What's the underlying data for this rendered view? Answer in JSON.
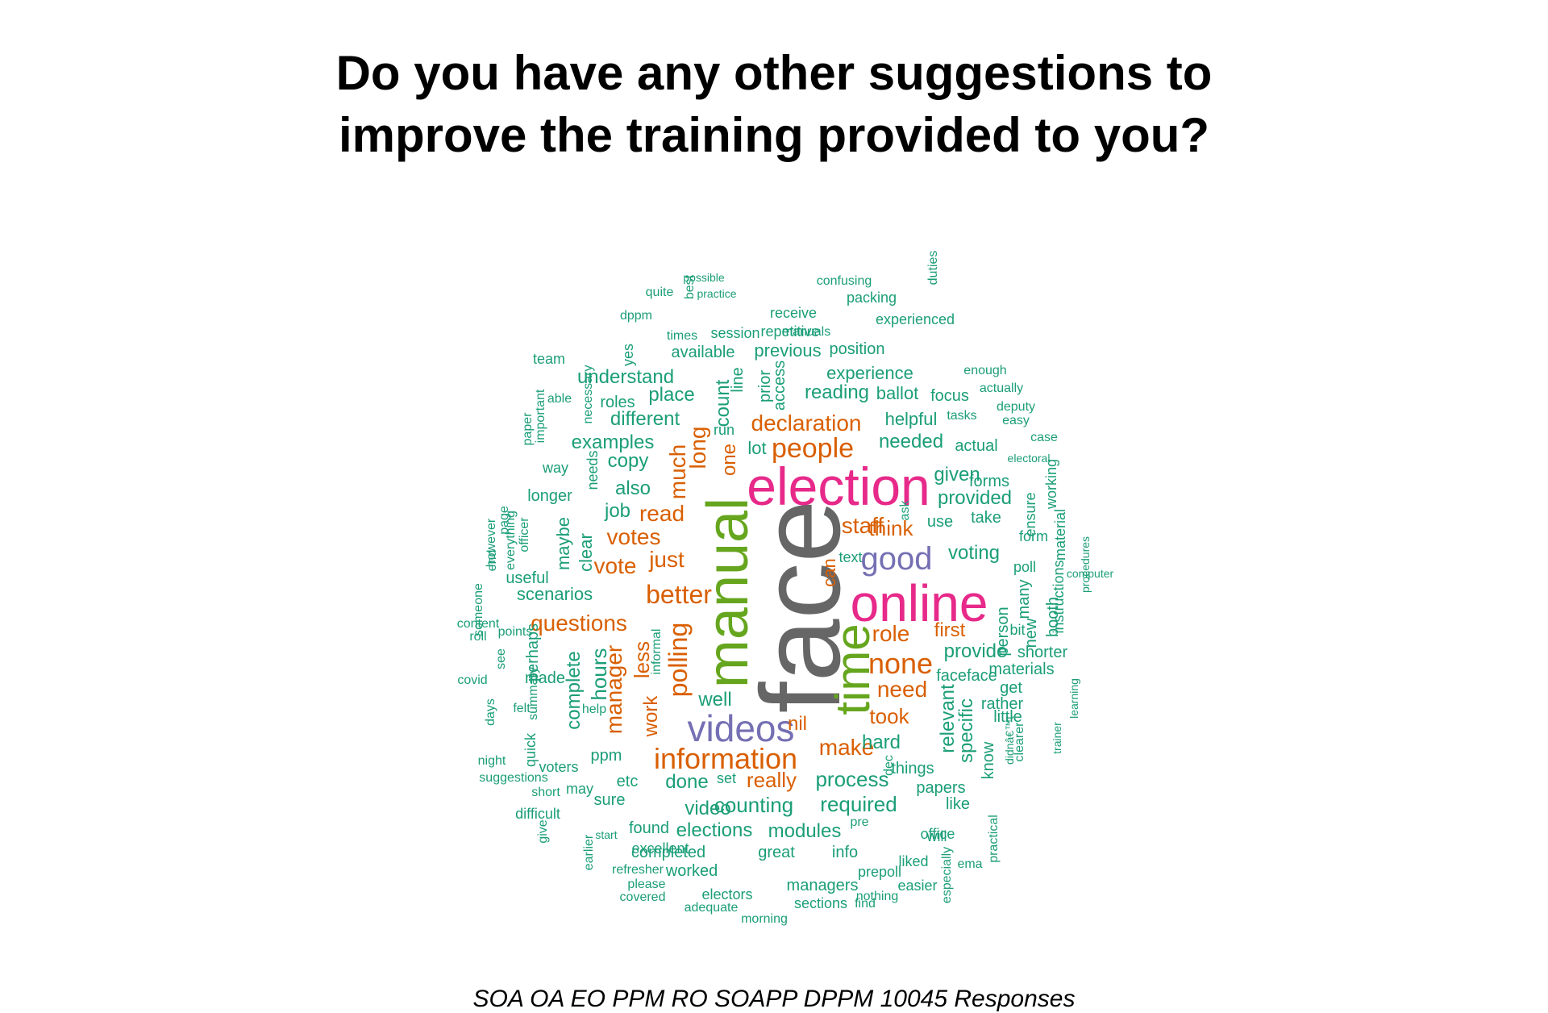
{
  "title": {
    "line1": "Do you have any other suggestions to",
    "line2": "improve the training provided to you?"
  },
  "footer": "SOA OA EO PPM RO SOAPP DPPM 10045 Responses",
  "colors": {
    "gray": "#666666",
    "green": "#66a61e",
    "pink": "#e7298a",
    "purple": "#7570b3",
    "orange": "#d95f02",
    "teal": "#1b9e77"
  },
  "words": [
    {
      "t": "face",
      "c": "gray",
      "v": 1
    },
    {
      "t": "manual",
      "c": "green",
      "v": 1
    },
    {
      "t": "election",
      "c": "pink",
      "v": 0
    },
    {
      "t": "online",
      "c": "pink",
      "v": 0
    },
    {
      "t": "time",
      "c": "green",
      "v": 1
    },
    {
      "t": "videos",
      "c": "purple",
      "v": 0
    },
    {
      "t": "good",
      "c": "purple",
      "v": 0
    },
    {
      "t": "information",
      "c": "orange",
      "v": 0
    },
    {
      "t": "none",
      "c": "orange",
      "v": 0
    },
    {
      "t": "people",
      "c": "orange",
      "v": 0
    },
    {
      "t": "better",
      "c": "orange",
      "v": 0
    },
    {
      "t": "polling",
      "c": "orange",
      "v": 1
    },
    {
      "t": "declaration",
      "c": "orange",
      "v": 0
    },
    {
      "t": "staff",
      "c": "orange",
      "v": 0
    },
    {
      "t": "role",
      "c": "orange",
      "v": 0
    },
    {
      "t": "questions",
      "c": "orange",
      "v": 0
    },
    {
      "t": "make",
      "c": "orange",
      "v": 0
    },
    {
      "t": "need",
      "c": "orange",
      "v": 0
    },
    {
      "t": "votes",
      "c": "orange",
      "v": 0
    },
    {
      "t": "just",
      "c": "orange",
      "v": 0
    },
    {
      "t": "took",
      "c": "orange",
      "v": 0
    },
    {
      "t": "read",
      "c": "orange",
      "v": 0
    },
    {
      "t": "think",
      "c": "orange",
      "v": 0
    },
    {
      "t": "vote",
      "c": "orange",
      "v": 0
    },
    {
      "t": "really",
      "c": "orange",
      "v": 0
    },
    {
      "t": "first",
      "c": "orange",
      "v": 0
    },
    {
      "t": "long",
      "c": "orange",
      "v": 1
    },
    {
      "t": "much",
      "c": "orange",
      "v": 1
    },
    {
      "t": "one",
      "c": "orange",
      "v": 1
    },
    {
      "t": "can",
      "c": "orange",
      "v": 1
    },
    {
      "t": "manager",
      "c": "orange",
      "v": 1
    },
    {
      "t": "less",
      "c": "orange",
      "v": 1
    },
    {
      "t": "work",
      "c": "orange",
      "v": 1
    },
    {
      "t": "nil",
      "c": "orange",
      "v": 0
    },
    {
      "t": "hours",
      "c": "teal",
      "v": 1
    },
    {
      "t": "complete",
      "c": "teal",
      "v": 1
    },
    {
      "t": "process",
      "c": "teal",
      "v": 0
    },
    {
      "t": "counting",
      "c": "teal",
      "v": 0
    },
    {
      "t": "done",
      "c": "teal",
      "v": 0
    },
    {
      "t": "hard",
      "c": "teal",
      "v": 0
    },
    {
      "t": "provide",
      "c": "teal",
      "v": 0
    },
    {
      "t": "provided",
      "c": "teal",
      "v": 0
    },
    {
      "t": "voting",
      "c": "teal",
      "v": 0
    },
    {
      "t": "relevant",
      "c": "teal",
      "v": 1
    },
    {
      "t": "specific",
      "c": "teal",
      "v": 1
    },
    {
      "t": "required",
      "c": "teal",
      "v": 0
    },
    {
      "t": "elections",
      "c": "teal",
      "v": 0
    },
    {
      "t": "modules",
      "c": "teal",
      "v": 0
    },
    {
      "t": "video",
      "c": "teal",
      "v": 0
    },
    {
      "t": "well",
      "c": "teal",
      "v": 0
    },
    {
      "t": "also",
      "c": "teal",
      "v": 0
    },
    {
      "t": "job",
      "c": "teal",
      "v": 0
    },
    {
      "t": "copy",
      "c": "teal",
      "v": 0
    },
    {
      "t": "examples",
      "c": "teal",
      "v": 0
    },
    {
      "t": "different",
      "c": "teal",
      "v": 0
    },
    {
      "t": "place",
      "c": "teal",
      "v": 0
    },
    {
      "t": "understand",
      "c": "teal",
      "v": 0
    },
    {
      "t": "roles",
      "c": "teal",
      "v": 0
    },
    {
      "t": "count",
      "c": "teal",
      "v": 1
    },
    {
      "t": "run",
      "c": "teal",
      "v": 0
    },
    {
      "t": "lot",
      "c": "teal",
      "v": 0
    },
    {
      "t": "reading",
      "c": "teal",
      "v": 0
    },
    {
      "t": "ballot",
      "c": "teal",
      "v": 0
    },
    {
      "t": "focus",
      "c": "teal",
      "v": 0
    },
    {
      "t": "helpful",
      "c": "teal",
      "v": 0
    },
    {
      "t": "needed",
      "c": "teal",
      "v": 0
    },
    {
      "t": "actual",
      "c": "teal",
      "v": 0
    },
    {
      "t": "given",
      "c": "teal",
      "v": 0
    },
    {
      "t": "forms",
      "c": "teal",
      "v": 0
    },
    {
      "t": "use",
      "c": "teal",
      "v": 0
    },
    {
      "t": "take",
      "c": "teal",
      "v": 0
    },
    {
      "t": "experience",
      "c": "teal",
      "v": 0
    },
    {
      "t": "previous",
      "c": "teal",
      "v": 0
    },
    {
      "t": "position",
      "c": "teal",
      "v": 0
    },
    {
      "t": "available",
      "c": "teal",
      "v": 0
    },
    {
      "t": "scenarios",
      "c": "teal",
      "v": 0
    },
    {
      "t": "useful",
      "c": "teal",
      "v": 0
    },
    {
      "t": "longer",
      "c": "teal",
      "v": 0
    },
    {
      "t": "maybe",
      "c": "teal",
      "v": 1
    },
    {
      "t": "clear",
      "c": "teal",
      "v": 1
    },
    {
      "t": "needs",
      "c": "teal",
      "v": 1
    },
    {
      "t": "way",
      "c": "teal",
      "v": 0
    },
    {
      "t": "ppm",
      "c": "teal",
      "v": 0
    },
    {
      "t": "etc",
      "c": "teal",
      "v": 0
    },
    {
      "t": "sure",
      "c": "teal",
      "v": 0
    },
    {
      "t": "found",
      "c": "teal",
      "v": 0
    },
    {
      "t": "completed",
      "c": "teal",
      "v": 0
    },
    {
      "t": "great",
      "c": "teal",
      "v": 0
    },
    {
      "t": "info",
      "c": "teal",
      "v": 0
    },
    {
      "t": "worked",
      "c": "teal",
      "v": 0
    },
    {
      "t": "managers",
      "c": "teal",
      "v": 0
    },
    {
      "t": "materials",
      "c": "teal",
      "v": 0
    },
    {
      "t": "faceface",
      "c": "teal",
      "v": 0
    },
    {
      "t": "get",
      "c": "teal",
      "v": 0
    },
    {
      "t": "rather",
      "c": "teal",
      "v": 0
    },
    {
      "t": "little",
      "c": "teal",
      "v": 0
    },
    {
      "t": "papers",
      "c": "teal",
      "v": 0
    },
    {
      "t": "like",
      "c": "teal",
      "v": 0
    },
    {
      "t": "office",
      "c": "teal",
      "v": 0
    },
    {
      "t": "things",
      "c": "teal",
      "v": 0
    },
    {
      "t": "know",
      "c": "teal",
      "v": 1
    },
    {
      "t": "person",
      "c": "teal",
      "v": 1
    },
    {
      "t": "many",
      "c": "teal",
      "v": 1
    },
    {
      "t": "new",
      "c": "teal",
      "v": 1
    },
    {
      "t": "bit",
      "c": "teal",
      "v": 0
    },
    {
      "t": "poll",
      "c": "teal",
      "v": 0
    },
    {
      "t": "shorter",
      "c": "teal",
      "v": 0
    },
    {
      "t": "instructions",
      "c": "teal",
      "v": 1
    },
    {
      "t": "booth",
      "c": "teal",
      "v": 1
    },
    {
      "t": "ensure",
      "c": "teal",
      "v": 1
    },
    {
      "t": "working",
      "c": "teal",
      "v": 1
    },
    {
      "t": "form",
      "c": "teal",
      "v": 0
    },
    {
      "t": "material",
      "c": "teal",
      "v": 1
    },
    {
      "t": "perhaps",
      "c": "teal",
      "v": 1
    },
    {
      "t": "made",
      "c": "teal",
      "v": 0
    },
    {
      "t": "voters",
      "c": "teal",
      "v": 0
    },
    {
      "t": "quick",
      "c": "teal",
      "v": 1
    },
    {
      "t": "help",
      "c": "teal",
      "v": 0
    },
    {
      "t": "may",
      "c": "teal",
      "v": 0
    },
    {
      "t": "short",
      "c": "teal",
      "v": 0
    },
    {
      "t": "suggestions",
      "c": "teal",
      "v": 0
    },
    {
      "t": "difficult",
      "c": "teal",
      "v": 0
    },
    {
      "t": "give",
      "c": "teal",
      "v": 1
    },
    {
      "t": "start",
      "c": "teal",
      "v": 0
    },
    {
      "t": "excellent",
      "c": "teal",
      "v": 0
    },
    {
      "t": "refresher",
      "c": "teal",
      "v": 0
    },
    {
      "t": "please",
      "c": "teal",
      "v": 0
    },
    {
      "t": "covered",
      "c": "teal",
      "v": 0
    },
    {
      "t": "electors",
      "c": "teal",
      "v": 0
    },
    {
      "t": "adequate",
      "c": "teal",
      "v": 0
    },
    {
      "t": "morning",
      "c": "teal",
      "v": 0
    },
    {
      "t": "sections",
      "c": "teal",
      "v": 0
    },
    {
      "t": "find",
      "c": "teal",
      "v": 0
    },
    {
      "t": "nothing",
      "c": "teal",
      "v": 0
    },
    {
      "t": "easier",
      "c": "teal",
      "v": 0
    },
    {
      "t": "prepoll",
      "c": "teal",
      "v": 0
    },
    {
      "t": "liked",
      "c": "teal",
      "v": 0
    },
    {
      "t": "pre",
      "c": "teal",
      "v": 0
    },
    {
      "t": "will",
      "c": "teal",
      "v": 0
    },
    {
      "t": "set",
      "c": "teal",
      "v": 0
    },
    {
      "t": "dec",
      "c": "teal",
      "v": 1
    },
    {
      "t": "text",
      "c": "teal",
      "v": 0
    },
    {
      "t": "ask",
      "c": "teal",
      "v": 1
    },
    {
      "t": "informal",
      "c": "teal",
      "v": 1
    },
    {
      "t": "earlier",
      "c": "teal",
      "v": 1
    },
    {
      "t": "especially",
      "c": "teal",
      "v": 1
    },
    {
      "t": "ema",
      "c": "teal",
      "v": 0
    },
    {
      "t": "practical",
      "c": "teal",
      "v": 1
    },
    {
      "t": "clearer",
      "c": "teal",
      "v": 1
    },
    {
      "t": "didnâ€™t",
      "c": "teal",
      "v": 1
    },
    {
      "t": "trainer",
      "c": "teal",
      "v": 1
    },
    {
      "t": "learning",
      "c": "teal",
      "v": 1
    },
    {
      "t": "procedures",
      "c": "teal",
      "v": 1
    },
    {
      "t": "computer",
      "c": "teal",
      "v": 0
    },
    {
      "t": "case",
      "c": "teal",
      "v": 0
    },
    {
      "t": "electoral",
      "c": "teal",
      "v": 0
    },
    {
      "t": "easy",
      "c": "teal",
      "v": 0
    },
    {
      "t": "tasks",
      "c": "teal",
      "v": 0
    },
    {
      "t": "deputy",
      "c": "teal",
      "v": 0
    },
    {
      "t": "actually",
      "c": "teal",
      "v": 0
    },
    {
      "t": "enough",
      "c": "teal",
      "v": 0
    },
    {
      "t": "duties",
      "c": "teal",
      "v": 1
    },
    {
      "t": "experienced",
      "c": "teal",
      "v": 0
    },
    {
      "t": "packing",
      "c": "teal",
      "v": 0
    },
    {
      "t": "confusing",
      "c": "teal",
      "v": 0
    },
    {
      "t": "receive",
      "c": "teal",
      "v": 0
    },
    {
      "t": "repetitive",
      "c": "teal",
      "v": 0
    },
    {
      "t": "manuals",
      "c": "teal",
      "v": 0
    },
    {
      "t": "session",
      "c": "teal",
      "v": 0
    },
    {
      "t": "times",
      "c": "teal",
      "v": 0
    },
    {
      "t": "dppm",
      "c": "teal",
      "v": 0
    },
    {
      "t": "practice",
      "c": "teal",
      "v": 0
    },
    {
      "t": "best",
      "c": "teal",
      "v": 1
    },
    {
      "t": "possible",
      "c": "teal",
      "v": 0
    },
    {
      "t": "quite",
      "c": "teal",
      "v": 0
    },
    {
      "t": "yes",
      "c": "teal",
      "v": 1
    },
    {
      "t": "line",
      "c": "teal",
      "v": 1
    },
    {
      "t": "prior",
      "c": "teal",
      "v": 1
    },
    {
      "t": "access",
      "c": "teal",
      "v": 1
    },
    {
      "t": "necessary",
      "c": "teal",
      "v": 1
    },
    {
      "t": "team",
      "c": "teal",
      "v": 0
    },
    {
      "t": "able",
      "c": "teal",
      "v": 0
    },
    {
      "t": "important",
      "c": "teal",
      "v": 1
    },
    {
      "t": "paper",
      "c": "teal",
      "v": 1
    },
    {
      "t": "page",
      "c": "teal",
      "v": 1
    },
    {
      "t": "everything",
      "c": "teal",
      "v": 1
    },
    {
      "t": "officer",
      "c": "teal",
      "v": 1
    },
    {
      "t": "end",
      "c": "teal",
      "v": 1
    },
    {
      "t": "however",
      "c": "teal",
      "v": 1
    },
    {
      "t": "someone",
      "c": "teal",
      "v": 1
    },
    {
      "t": "content",
      "c": "teal",
      "v": 0
    },
    {
      "t": "roll",
      "c": "teal",
      "v": 0
    },
    {
      "t": "points",
      "c": "teal",
      "v": 0
    },
    {
      "t": "see",
      "c": "teal",
      "v": 1
    },
    {
      "t": "covid",
      "c": "teal",
      "v": 0
    },
    {
      "t": "days",
      "c": "teal",
      "v": 1
    },
    {
      "t": "summary",
      "c": "teal",
      "v": 1
    },
    {
      "t": "felt",
      "c": "teal",
      "v": 0
    },
    {
      "t": "night",
      "c": "teal",
      "v": 0
    },
    {
      "t": "question",
      "c": "teal",
      "v": 0
    }
  ]
}
